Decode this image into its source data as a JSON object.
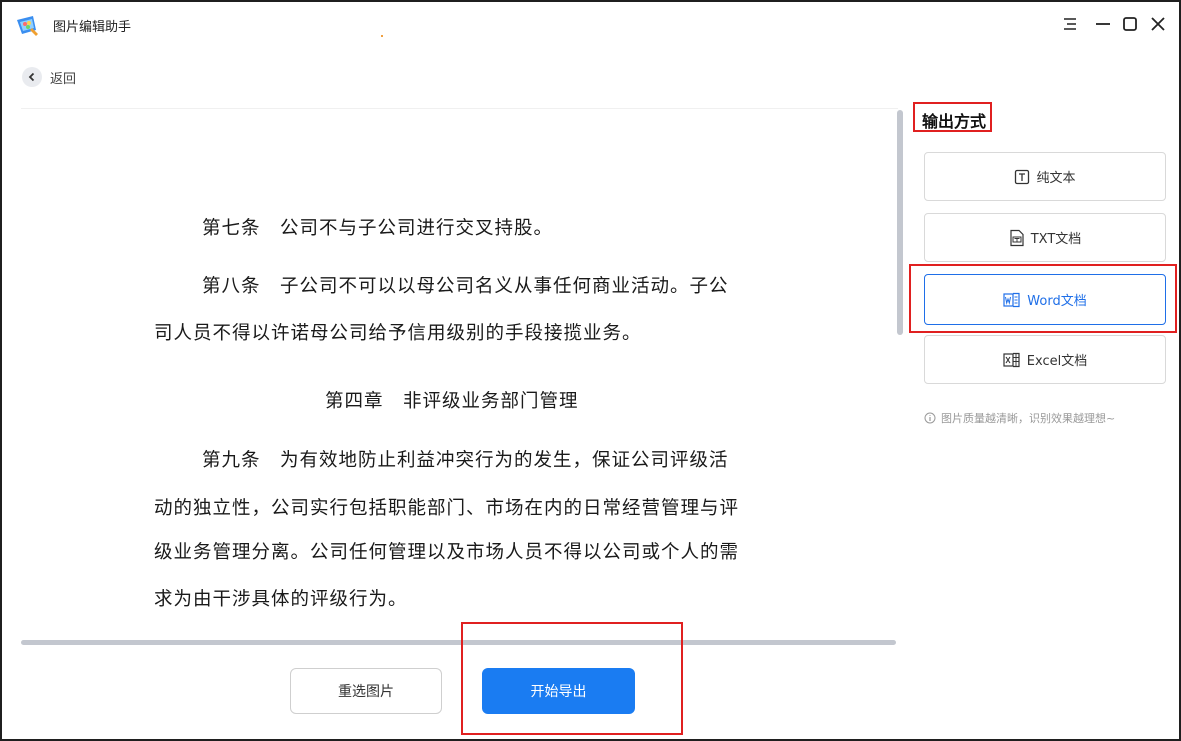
{
  "app": {
    "title": "图片编辑助手",
    "logo_icon": "paint-palette-icon"
  },
  "window_controls": [
    "menu-icon",
    "minimize-icon",
    "maximize-icon",
    "close-icon"
  ],
  "nav": {
    "back_label": "返回"
  },
  "document": {
    "paragraphs": [
      {
        "id": "p1",
        "text": "第七条　公司不与子公司进行交叉持股。"
      },
      {
        "id": "p2a",
        "text": "第八条　子公司不可以以母公司名义从事任何商业活动。子公"
      },
      {
        "id": "p2b",
        "text": "司人员不得以许诺母公司给予信用级别的手段接揽业务。"
      },
      {
        "id": "h1",
        "text": "第四章　非评级业务部门管理"
      },
      {
        "id": "p3a",
        "text": "第九条　为有效地防止利益冲突行为的发生，保证公司评级活"
      },
      {
        "id": "p3b",
        "text": "动的独立性，公司实行包括职能部门、市场在内的日常经营管理与评"
      },
      {
        "id": "p3c",
        "text": "级业务管理分离。公司任何管理以及市场人员不得以公司或个人的需"
      },
      {
        "id": "p3d",
        "text": "求为由干涉具体的评级行为。"
      }
    ]
  },
  "output": {
    "title": "输出方式",
    "options": [
      {
        "label": "纯文本",
        "icon": "text-box-icon",
        "selected": false
      },
      {
        "label": "TXT文档",
        "icon": "txt-file-icon",
        "selected": false
      },
      {
        "label": "Word文档",
        "icon": "word-file-icon",
        "selected": true
      },
      {
        "label": "Excel文档",
        "icon": "excel-file-icon",
        "selected": false
      }
    ],
    "hint": "图片质量越清晰，识别效果越理想~"
  },
  "actions": {
    "reselect_label": "重选图片",
    "export_label": "开始导出"
  },
  "colors": {
    "accent": "#1a7cf2",
    "highlight": "#e02020"
  }
}
